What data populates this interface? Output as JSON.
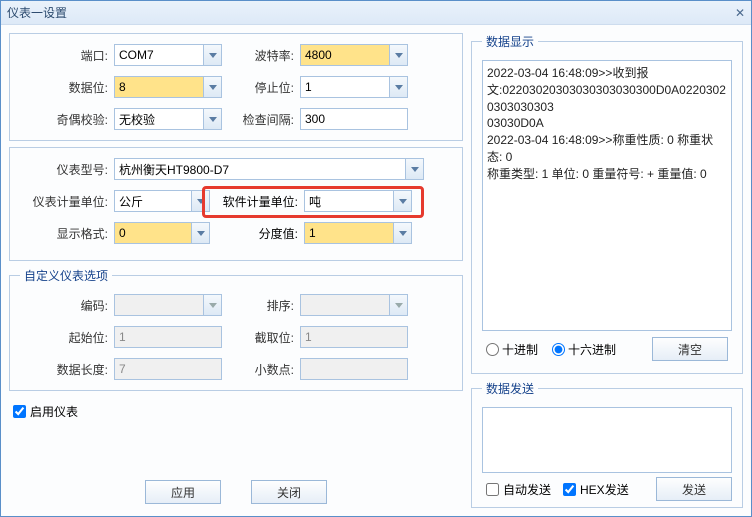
{
  "window": {
    "title": "仪表一设置",
    "close": "✕"
  },
  "labels": {
    "port": "端口:",
    "baud": "波特率:",
    "databits": "数据位:",
    "stopbits": "停止位:",
    "parity": "奇偶校验:",
    "checkinterval": "检查间隔:",
    "model": "仪表型号:",
    "meterunit": "仪表计量单位:",
    "softunit": "软件计量单位:",
    "dispfmt": "显示格式:",
    "division": "分度值:",
    "encoding": "编码:",
    "sort": "排序:",
    "startbit": "起始位:",
    "cutbit": "截取位:",
    "datalen": "数据长度:",
    "decimal": "小数点:"
  },
  "values": {
    "port": "COM7",
    "baud": "4800",
    "databits": "8",
    "stopbits": "1",
    "parity": "无校验",
    "checkinterval": "300",
    "model": "杭州衡天HT9800-D7",
    "meterunit": "公斤",
    "softunit": "吨",
    "dispfmt": "0",
    "division": "1",
    "encoding": "",
    "sort": "",
    "startbit": "1",
    "cutbit": "1",
    "datalen": "7",
    "decimal": ""
  },
  "sections": {
    "custom": "自定义仪表选项",
    "datadisplay": "数据显示",
    "datasend": "数据发送"
  },
  "checks": {
    "enable": "启用仪表",
    "autosend": "自动发送",
    "hexsend": "HEX发送"
  },
  "radios": {
    "dec": "十进制",
    "hex": "十六进制"
  },
  "buttons": {
    "apply": "应用",
    "close": "关闭",
    "clear": "清空",
    "send": "发送"
  },
  "log": {
    "l1": "2022-03-04 16:48:09>>收到报",
    "l2": "文:02203020303030303030300D0A02203020303030303",
    "l3": "03030D0A",
    "l4": "2022-03-04 16:48:09>>称重性质: 0 称重状态: 0",
    "l5": "称重类型: 1 单位: 0 重量符号: + 重量值: 0"
  }
}
